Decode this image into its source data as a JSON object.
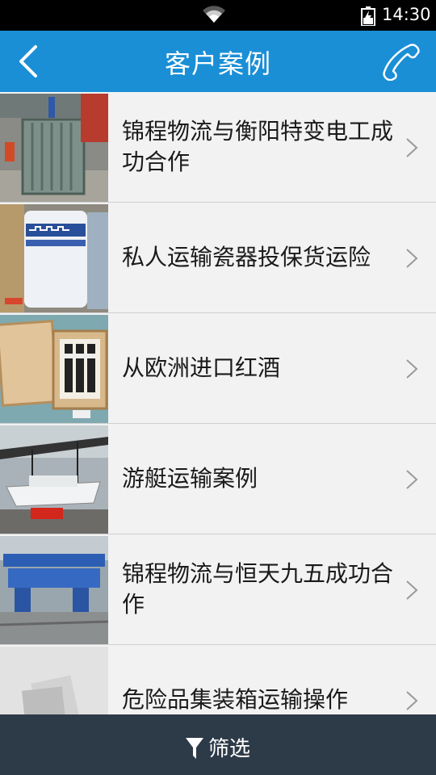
{
  "status_bar": {
    "time": "14:30"
  },
  "header": {
    "title": "客户案例",
    "back_icon": "chevron-left-icon",
    "call_icon": "phone-icon",
    "bg_color": "#1a8fd6"
  },
  "cases": [
    {
      "title": "锦程物流与衡阳特变电工成功合作",
      "thumb": "transformer-cargo-photo"
    },
    {
      "title": "私人运输瓷器投保货运险",
      "thumb": "porcelain-vase-photo"
    },
    {
      "title": "从欧洲进口红酒",
      "thumb": "wine-crate-photo"
    },
    {
      "title": "游艇运输案例",
      "thumb": "yacht-lift-photo"
    },
    {
      "title": "锦程物流与恒天九五成功合作",
      "thumb": "machinery-loading-photo"
    },
    {
      "title": "危险品集装箱运输操作",
      "thumb": "placeholder-image"
    }
  ],
  "filter": {
    "label": "筛选",
    "icon": "funnel-icon",
    "bg_color": "#2d3a48"
  }
}
